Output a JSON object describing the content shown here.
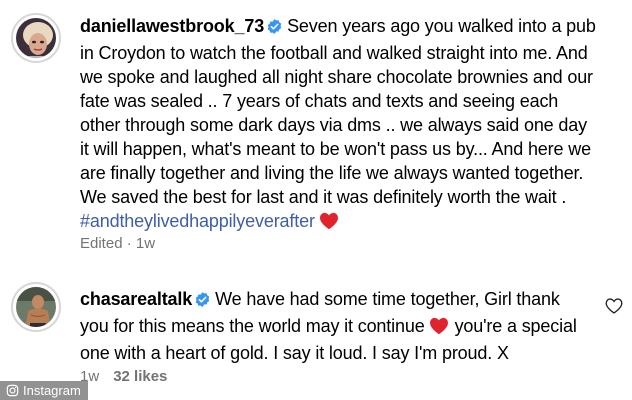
{
  "comments": [
    {
      "username": "daniellawestbrook_73",
      "text": "Seven years ago you walked into a pub in Croydon to watch the football and walked straight into me. And we spoke and laughed all night share chocolate brownies and our fate was sealed .. 7 years of chats and texts and seeing each other through some dark days via dms .. we always said one day it will happen, what's meant to be won't pass us by... And here we are finally together and living the life we always wanted together. We saved the best for last and it was definitely worth the wait .",
      "hashtag": "#andtheylivedhappilyeverafter",
      "edited_label": "Edited",
      "separator": "·",
      "age": "1w",
      "icons": [
        "verified-badge-icon",
        "red-heart-emoji"
      ]
    },
    {
      "username": "chasarealtalk",
      "text_part1": "We have had some time together, Girl thank you for this means the world may it continue",
      "text_part2": "you're a special one with a heart of gold. I say it loud. I say I'm proud. X",
      "age": "1w",
      "likes": "32 likes",
      "icons": [
        "verified-badge-icon",
        "red-heart-emoji",
        "heart-outline-icon"
      ]
    }
  ],
  "watermark": {
    "text": "Instagram",
    "icon": "instagram-logo-icon"
  },
  "colors": {
    "verified": "#3797f0",
    "hashtag": "#3f5ea8",
    "heart": "#e0242e",
    "meta_text": "#737373"
  }
}
